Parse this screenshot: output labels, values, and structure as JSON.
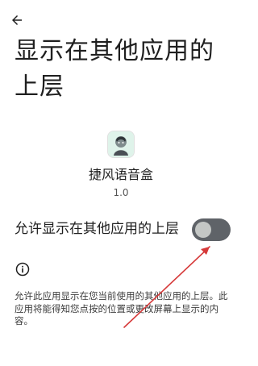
{
  "header": {
    "back_icon": "arrow-left-icon",
    "title": "显示在其他应用的上层"
  },
  "app": {
    "icon": "app-logo-icon",
    "name": "捷风语音盒",
    "version": "1.0"
  },
  "setting": {
    "label": "允许显示在其他应用的上层",
    "toggle_state": "off"
  },
  "info": {
    "icon": "info-icon",
    "description": "允许此应用显示在您当前使用的其他应用的上层。此应用将能得知您点按的位置或更改屏幕上显示的内容。"
  },
  "annotation": {
    "color": "#d63a3a"
  },
  "colors": {
    "switch_track": "#5f6368",
    "switch_thumb": "#c4c7c5",
    "background": "#ffffff"
  }
}
